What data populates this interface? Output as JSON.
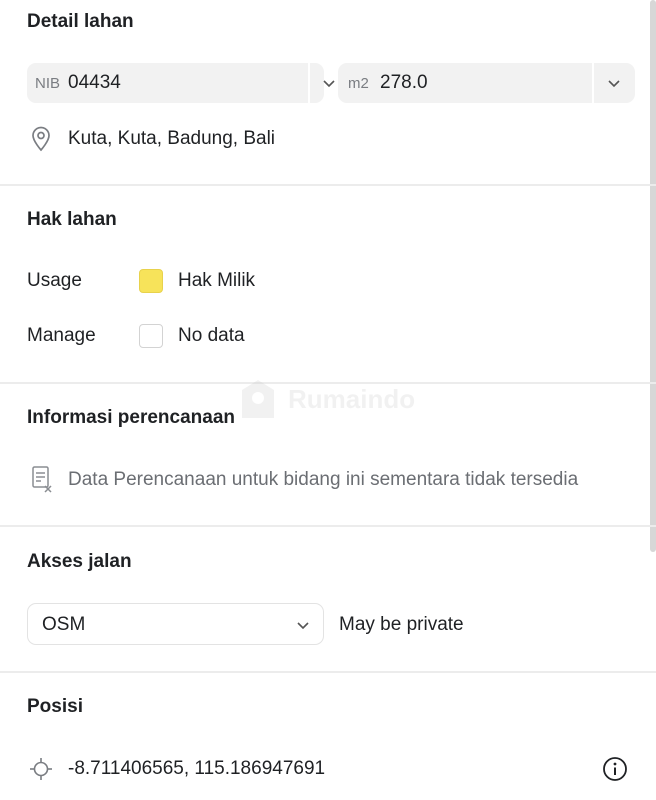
{
  "detail_lahan": {
    "heading": "Detail lahan",
    "nib_prefix": "NIB",
    "nib_value": "04434",
    "area_prefix": "m2",
    "area_value": "278.0",
    "location": "Kuta, Kuta, Badung, Bali"
  },
  "hak_lahan": {
    "heading": "Hak lahan",
    "rows": [
      {
        "label": "Usage",
        "value": "Hak Milik",
        "color": "#f7e35a"
      },
      {
        "label": "Manage",
        "value": "No data",
        "color": "#ffffff"
      }
    ]
  },
  "informasi_perencanaan": {
    "heading": "Informasi perencanaan",
    "message": "Data Perencanaan untuk bidang ini sementara tidak tersedia"
  },
  "akses_jalan": {
    "heading": "Akses jalan",
    "source_value": "OSM",
    "status": "May be private"
  },
  "posisi": {
    "heading": "Posisi",
    "coordinates": "-8.711406565, 115.186947691"
  },
  "watermark": {
    "text": "Rumaindo"
  },
  "icons": [
    "chevron-down-icon",
    "location-pin-icon",
    "document-x-icon",
    "crosshair-icon",
    "info-icon"
  ]
}
